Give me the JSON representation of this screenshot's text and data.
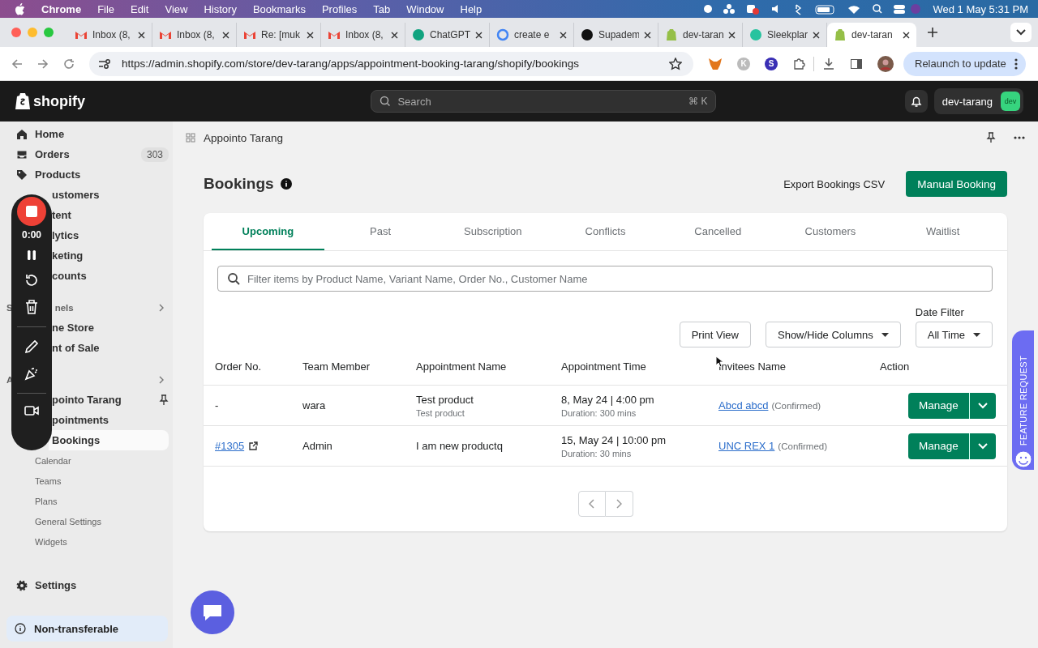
{
  "menubar": {
    "app": "Chrome",
    "menus": [
      "File",
      "Edit",
      "View",
      "History",
      "Bookmarks",
      "Profiles",
      "Tab",
      "Window",
      "Help"
    ],
    "clock": "Wed 1 May  5:31 PM"
  },
  "browser_tabs": [
    {
      "title": "Inbox (8,",
      "selected": false
    },
    {
      "title": "Inbox (8,",
      "selected": false
    },
    {
      "title": "Re: [muk",
      "selected": false
    },
    {
      "title": "Inbox (8,",
      "selected": false
    },
    {
      "title": "ChatGPT",
      "selected": false
    },
    {
      "title": "create e",
      "selected": false
    },
    {
      "title": "Supadem",
      "selected": false
    },
    {
      "title": "dev-taran",
      "selected": false
    },
    {
      "title": "Sleekplar",
      "selected": false
    },
    {
      "title": "dev-taran",
      "selected": true
    }
  ],
  "address_bar": {
    "url": "https://admin.shopify.com/store/dev-tarang/apps/appointment-booking-tarang/shopify/bookings",
    "extension_letters": [
      "K",
      "S"
    ],
    "relaunch": "Relaunch to update"
  },
  "topbar": {
    "logo": "shopify",
    "search_placeholder": "Search",
    "shortcut": "⌘ K",
    "store": "dev-tarang",
    "avatar": "dev"
  },
  "sidebar": {
    "items": [
      {
        "kind": "nav",
        "label": "Home",
        "selected": false
      },
      {
        "kind": "nav",
        "label": "Orders",
        "badge": "303",
        "selected": false
      },
      {
        "kind": "nav",
        "label": "Products",
        "selected": false
      },
      {
        "kind": "partial",
        "label": "ustomers",
        "selected": false
      },
      {
        "kind": "partial",
        "label": "tent",
        "selected": false
      },
      {
        "kind": "partial",
        "label": "lytics",
        "selected": false
      },
      {
        "kind": "partial",
        "label": "keting",
        "selected": false
      },
      {
        "kind": "partial",
        "label": "counts",
        "selected": false
      },
      {
        "kind": "section",
        "prefix": "S",
        "label": "nels"
      },
      {
        "kind": "partial",
        "label": "ne Store",
        "selected": false
      },
      {
        "kind": "partial",
        "label": "nt of Sale",
        "selected": false
      },
      {
        "kind": "section",
        "prefix": "A"
      },
      {
        "kind": "partial",
        "label": "pointo Tarang",
        "pinned": true,
        "selected": false
      },
      {
        "kind": "partial",
        "label": "pointments",
        "selected": false
      },
      {
        "kind": "partial",
        "label": "Bookings",
        "selected": true
      },
      {
        "kind": "sub",
        "label": "Calendar",
        "selected": false
      },
      {
        "kind": "sub",
        "label": "Teams",
        "selected": false
      },
      {
        "kind": "sub",
        "label": "Plans",
        "selected": false
      },
      {
        "kind": "sub",
        "label": "General Settings",
        "selected": false
      },
      {
        "kind": "sub",
        "label": "Widgets",
        "selected": false
      }
    ],
    "settings": "Settings",
    "notice": "Non-transferable"
  },
  "recorder": {
    "timer": "0:00"
  },
  "app_header": {
    "title": "Appointo Tarang"
  },
  "page": {
    "title": "Bookings",
    "export_button": "Export Bookings CSV",
    "primary_button": "Manual Booking"
  },
  "tabs": [
    {
      "label": "Upcoming",
      "selected": true
    },
    {
      "label": "Past",
      "selected": false
    },
    {
      "label": "Subscription",
      "selected": false
    },
    {
      "label": "Conflicts",
      "selected": false
    },
    {
      "label": "Cancelled",
      "selected": false
    },
    {
      "label": "Customers",
      "selected": false
    },
    {
      "label": "Waitlist",
      "selected": false
    }
  ],
  "filter": {
    "placeholder": "Filter items by Product Name, Variant Name, Order No., Customer Name"
  },
  "toolbar": {
    "print": "Print View",
    "columns": "Show/Hide Columns",
    "date_label": "Date Filter",
    "date_value": "All Time"
  },
  "table": {
    "columns": [
      "Order No.",
      "Team Member",
      "Appointment Name",
      "Appointment Time",
      "Invitees Name",
      "Action"
    ],
    "rows": [
      {
        "order": "-",
        "order_link": false,
        "member": "wara",
        "name": "Test product",
        "variant": "Test product",
        "time": "8, May 24 | 4:00 pm",
        "duration": "Duration: 300 mins",
        "invitee": "Abcd abcd",
        "status": "(Confirmed)",
        "action": "Manage"
      },
      {
        "order": "#1305",
        "order_link": true,
        "member": "Admin",
        "name": "I am new productq",
        "time": "15, May 24 | 10:00 pm",
        "duration": "Duration: 30 mins",
        "invitee": "UNC REX 1",
        "status": "(Confirmed)",
        "action": "Manage"
      }
    ]
  },
  "feature_request": "FEATURE REQUEST"
}
